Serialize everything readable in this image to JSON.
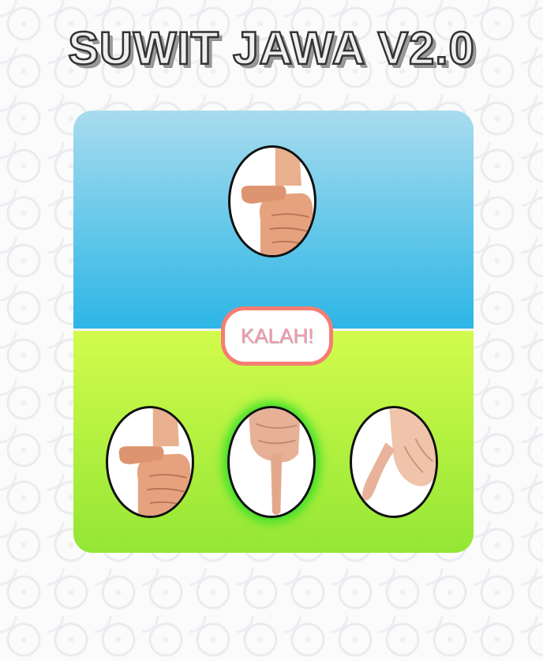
{
  "title": "SUWIT JAWA V2.0",
  "opponent": {
    "choice": "thumb",
    "icon": "thumb-hand-icon"
  },
  "result": {
    "label": "KALAH!",
    "color": "#f298ad",
    "border_color": "#f57d73"
  },
  "player": {
    "choices": [
      {
        "name": "thumb",
        "icon": "thumb-hand-icon",
        "selected": false
      },
      {
        "name": "index-finger",
        "icon": "index-finger-hand-icon",
        "selected": true
      },
      {
        "name": "pinky",
        "icon": "pinky-hand-icon",
        "selected": false
      }
    ]
  },
  "colors": {
    "top_panel": "#2cb6e6",
    "bottom_panel": "#a8ee3c",
    "selected_glow": "#3ee02a"
  }
}
